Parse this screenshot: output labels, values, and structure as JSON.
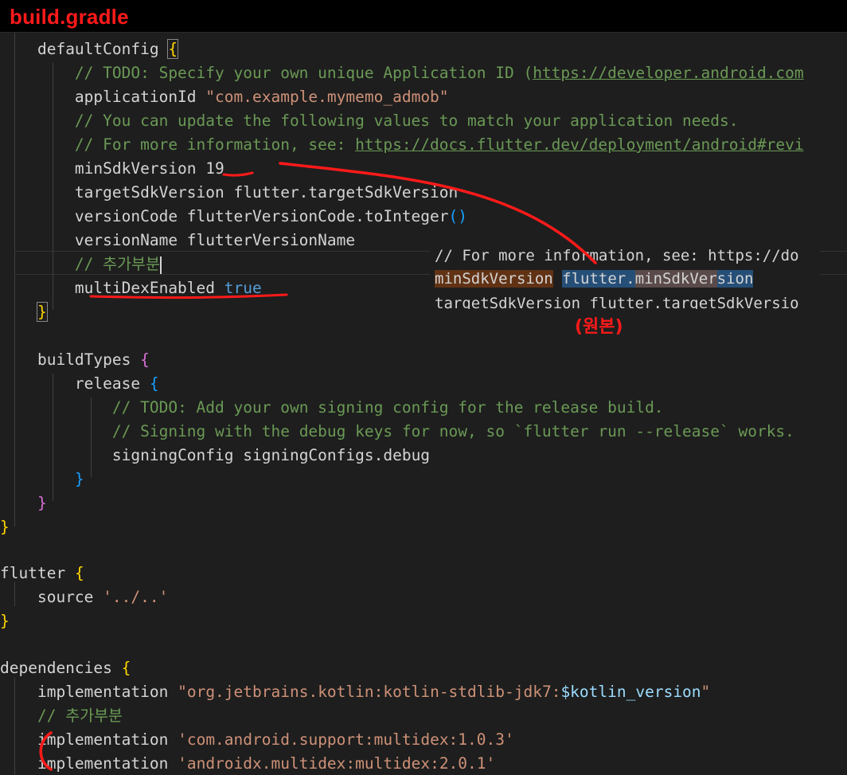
{
  "title": "build.gradle",
  "code": {
    "default_config": "defaultConfig",
    "todo_comment": "// TODO: Specify your own unique Application ID (",
    "todo_url": "https://developer.android.com",
    "app_id_key": "applicationId",
    "app_id_value": "\"com.example.mymemo_admob\"",
    "update_comment": "// You can update the following values to match your application needs.",
    "info_comment": "// For more information, see: ",
    "info_url": "https://docs.flutter.dev/deployment/android#revi",
    "min_sdk_key": "minSdkVersion",
    "min_sdk_value": "19",
    "target_sdk": "targetSdkVersion flutter.targetSdkVersion",
    "version_code": "versionCode flutterVersionCode.toInteger",
    "version_name": "versionName flutterVersionName",
    "added_comment": "// 추가부분",
    "multidex_key": "multiDexEnabled",
    "multidex_value": "true",
    "build_types": "buildTypes",
    "release": "release",
    "release_todo": "// TODO: Add your own signing config for the release build.",
    "release_signing_comment": "// Signing with the debug keys for now, so `flutter run --release` works.",
    "signing_config": "signingConfig signingConfigs.debug",
    "flutter_block": "flutter",
    "source_key": "source",
    "source_value": "'../..'",
    "dependencies": "dependencies",
    "impl_key": "implementation",
    "kotlin_dep_prefix": "\"org.jetbrains.kotlin:kotlin-stdlib-jdk7:",
    "kotlin_dep_var": "$kotlin_version",
    "kotlin_dep_suffix": "\"",
    "dep_comment": "// 추가부분",
    "multidex_dep_1": "'com.android.support:multidex:1.0.3'",
    "multidex_dep_2": "'androidx.multidex:multidex:2.0.1'"
  },
  "snippet": {
    "comment": "// For more information, see: https://do",
    "min_sdk_key": "minSdkVersion",
    "flutter_prefix": "flutter.",
    "min_sdk_ver": "minSdkVer",
    "sion": "sion",
    "target_line": "targetSdkVersion flutter.targetSdkVersio"
  },
  "original_label": "(원본)",
  "annotation_color": "#ff1a1a"
}
